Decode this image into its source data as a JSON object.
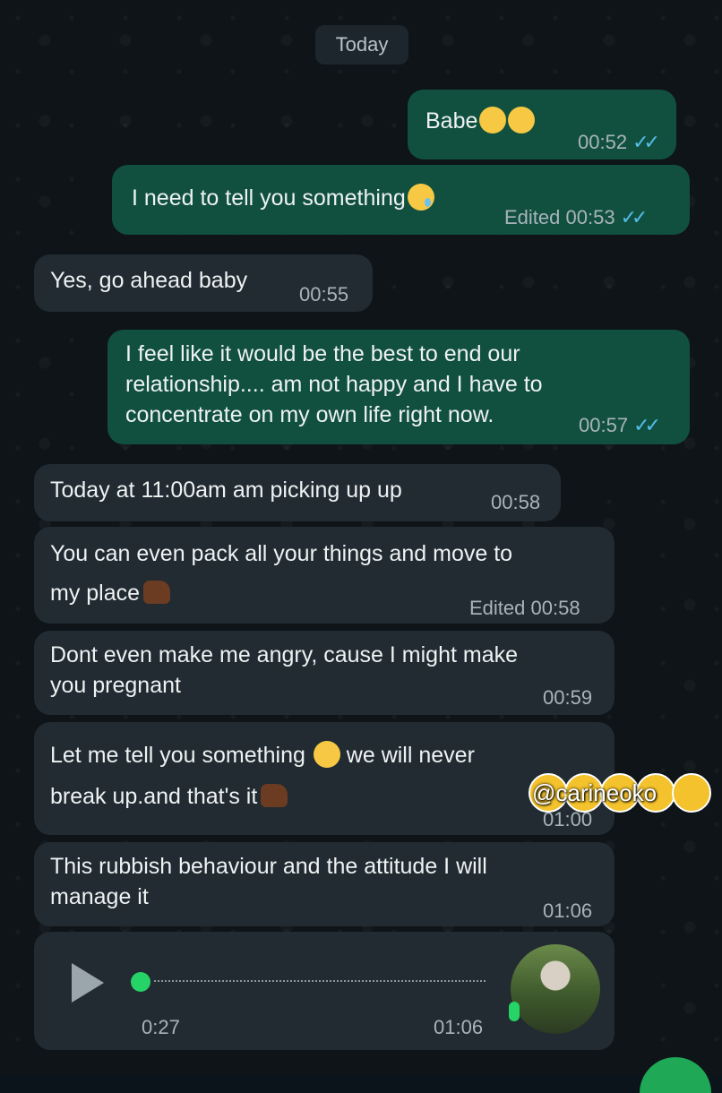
{
  "date_separator": "Today",
  "messages": [
    {
      "text": "Babe",
      "time": "00:52",
      "edited": ""
    },
    {
      "text": "I need to tell you something",
      "time": "00:53",
      "edited": "Edited"
    },
    {
      "text": "Yes, go ahead baby",
      "time": "00:55"
    },
    {
      "line1": "I feel like it would be the best to end our",
      "line2": "relationship.... am not happy and I have to",
      "line3": "concentrate on my own life right now.",
      "time": "00:57"
    },
    {
      "text": "Today at 11:00am am picking up up",
      "time": "00:58"
    },
    {
      "line1": "You can even pack all your things and move to",
      "line2": "my place",
      "time": "00:58",
      "edited": "Edited"
    },
    {
      "line1": "Dont even make me angry, cause I might make",
      "line2": "you pregnant",
      "time": "00:59"
    },
    {
      "line1a": "Let me tell you something",
      "line1b": "we will never",
      "line2": "break up.and that's it",
      "time": "01:00"
    },
    {
      "line1": "This rubbish behaviour and the attitude I will",
      "line2": "manage it",
      "time": "01:06"
    }
  ],
  "voice_note": {
    "position": "0:27",
    "time": "01:06"
  },
  "watermark": "@carineoko",
  "ticks": "✓✓",
  "colors": {
    "outgoing": "#11503f",
    "incoming": "#212b31",
    "ticks": "#53bdeb",
    "accent": "#25d366"
  }
}
